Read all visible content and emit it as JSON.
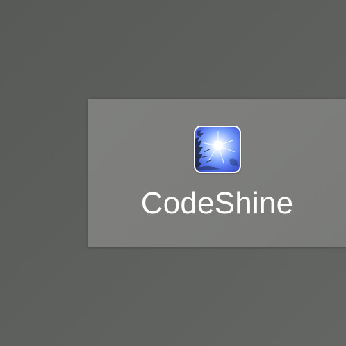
{
  "app_tile": {
    "name": "CodeShine",
    "icon": "sun-through-trees-icon"
  },
  "colors": {
    "desktop_background": "#5c5e5c",
    "tile_background": "#7e7f7d",
    "label": "#ffffff",
    "icon_sky": "#4f6fe8"
  }
}
